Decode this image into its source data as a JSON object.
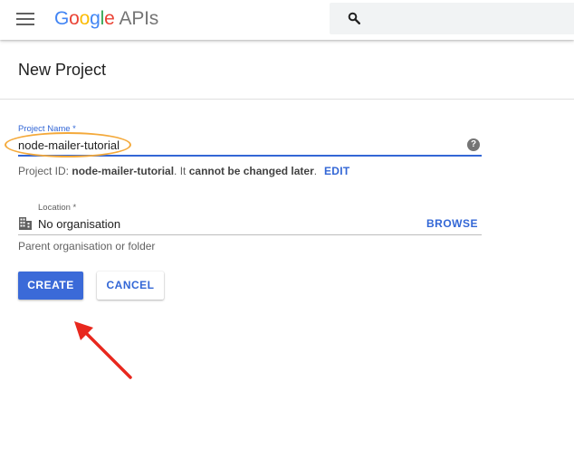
{
  "header": {
    "logo_google_letters": [
      {
        "char": "G",
        "color": "#4285F4"
      },
      {
        "char": "o",
        "color": "#EA4335"
      },
      {
        "char": "o",
        "color": "#FBBC05"
      },
      {
        "char": "g",
        "color": "#4285F4"
      },
      {
        "char": "l",
        "color": "#34A853"
      },
      {
        "char": "e",
        "color": "#EA4335"
      }
    ],
    "logo_suffix": "APIs",
    "menu_icon": "hamburger-menu-icon",
    "search_icon": "search-icon"
  },
  "page": {
    "title": "New Project"
  },
  "form": {
    "project_name": {
      "label": "Project Name *",
      "value": "node-mailer-tutorial",
      "help_icon_glyph": "?"
    },
    "project_id": {
      "prefix": "Project ID: ",
      "id": "node-mailer-tutorial",
      "middle": ". It ",
      "warning": "cannot be changed later",
      "suffix": ".",
      "edit_label": "EDIT"
    },
    "location": {
      "label": "Location *",
      "value": "No organisation",
      "browse_label": "BROWSE",
      "helper": "Parent organisation or folder",
      "icon": "building-icon"
    }
  },
  "actions": {
    "create_label": "CREATE",
    "cancel_label": "CANCEL"
  },
  "annotations": {
    "highlight_color": "#F4A93A",
    "arrow_color": "#E8281E"
  },
  "colors": {
    "accent": "#3367D6",
    "create_button": "#3B6AD8"
  }
}
